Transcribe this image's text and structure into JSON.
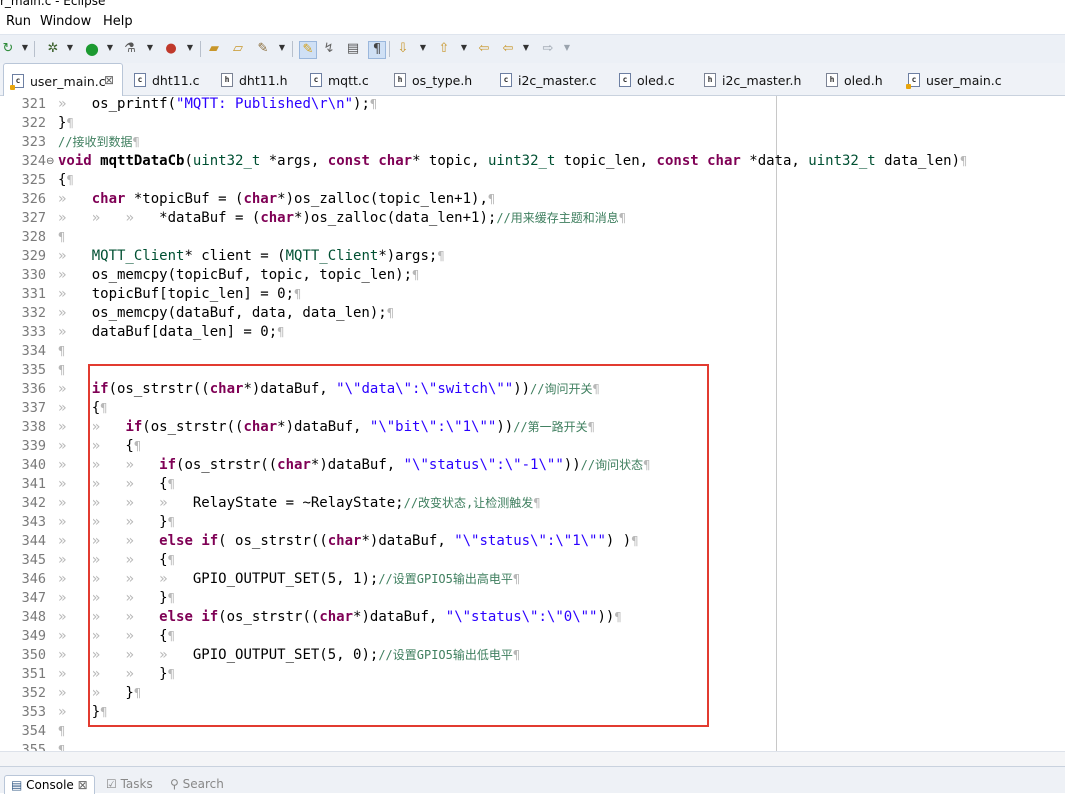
{
  "window": {
    "title": "r_main.c - Eclipse"
  },
  "menu": [
    "Run",
    "Window",
    "Help"
  ],
  "toolbar": {
    "icons": [
      "refresh-icon",
      "debug-icon",
      "run-icon",
      "external-tools-icon",
      "coverage-icon",
      "open-folder-icon",
      "open-file-icon",
      "wand-icon",
      "highlight-icon",
      "toggle-mark-icon",
      "block-select-icon",
      "show-whitespace-icon",
      "next-annotation-icon",
      "previous-annotation-icon",
      "last-edit-icon",
      "back-icon",
      "forward-icon"
    ]
  },
  "tabs": [
    {
      "label": "user_main.c",
      "kind": "c",
      "active": true,
      "close": "⊠",
      "warn": true
    },
    {
      "label": "dht11.c",
      "kind": "c"
    },
    {
      "label": "dht11.h",
      "kind": "h"
    },
    {
      "label": "mqtt.c",
      "kind": "c"
    },
    {
      "label": "os_type.h",
      "kind": "h"
    },
    {
      "label": "i2c_master.c",
      "kind": "c"
    },
    {
      "label": "oled.c",
      "kind": "c"
    },
    {
      "label": "i2c_master.h",
      "kind": "h"
    },
    {
      "label": "oled.h",
      "kind": "h"
    },
    {
      "label": "user_main.c",
      "kind": "c",
      "warn": true
    }
  ],
  "editor": {
    "lines": [
      {
        "n": "321",
        "segs": [
          [
            "g",
            "» "
          ],
          [
            "t",
            "  os_printf("
          ],
          [
            "s",
            "\"MQTT: Published\\r\\n\""
          ],
          [
            "t",
            ");"
          ],
          [
            "p",
            "¶"
          ]
        ]
      },
      {
        "n": "322",
        "segs": [
          [
            "t",
            "}"
          ],
          [
            "p",
            "¶"
          ]
        ]
      },
      {
        "n": "323",
        "segs": [
          [
            "c",
            "//接收到数据"
          ],
          [
            "p",
            "¶"
          ]
        ]
      },
      {
        "n": "324",
        "fold": "⊖",
        "segs": [
          [
            "k",
            "void"
          ],
          [
            "t",
            " "
          ],
          [
            "f",
            "mqttDataCb"
          ],
          [
            "t",
            "("
          ],
          [
            "y",
            "uint32_t"
          ],
          [
            "t",
            " *args, "
          ],
          [
            "k",
            "const"
          ],
          [
            "t",
            " "
          ],
          [
            "k",
            "char"
          ],
          [
            "t",
            "* topic, "
          ],
          [
            "y",
            "uint32_t"
          ],
          [
            "t",
            " topic_len, "
          ],
          [
            "k",
            "const"
          ],
          [
            "t",
            " "
          ],
          [
            "k",
            "char"
          ],
          [
            "t",
            " *data, "
          ],
          [
            "y",
            "uint32_t"
          ],
          [
            "t",
            " data_len)"
          ],
          [
            "p",
            "¶"
          ]
        ]
      },
      {
        "n": "325",
        "segs": [
          [
            "t",
            "{"
          ],
          [
            "p",
            "¶"
          ]
        ]
      },
      {
        "n": "326",
        "segs": [
          [
            "g",
            "» "
          ],
          [
            "t",
            "  "
          ],
          [
            "k",
            "char"
          ],
          [
            "t",
            " *topicBuf = ("
          ],
          [
            "k",
            "char"
          ],
          [
            "t",
            "*)os_zalloc(topic_len+1),"
          ],
          [
            "p",
            "¶"
          ]
        ]
      },
      {
        "n": "327",
        "segs": [
          [
            "g",
            "» "
          ],
          [
            "t",
            "  "
          ],
          [
            "g",
            "» "
          ],
          [
            "t",
            "  "
          ],
          [
            "g",
            "» "
          ],
          [
            "t",
            "  *dataBuf = ("
          ],
          [
            "k",
            "char"
          ],
          [
            "t",
            "*)os_zalloc(data_len+1);"
          ],
          [
            "c",
            "//用来缓存主题和消息"
          ],
          [
            "p",
            "¶"
          ]
        ]
      },
      {
        "n": "328",
        "segs": [
          [
            "p",
            "¶"
          ]
        ]
      },
      {
        "n": "329",
        "segs": [
          [
            "g",
            "» "
          ],
          [
            "t",
            "  "
          ],
          [
            "y",
            "MQTT_Client"
          ],
          [
            "t",
            "* client = ("
          ],
          [
            "y",
            "MQTT_Client"
          ],
          [
            "t",
            "*)args;"
          ],
          [
            "p",
            "¶"
          ]
        ]
      },
      {
        "n": "330",
        "segs": [
          [
            "g",
            "» "
          ],
          [
            "t",
            "  os_memcpy(topicBuf, topic, topic_len);"
          ],
          [
            "p",
            "¶"
          ]
        ]
      },
      {
        "n": "331",
        "segs": [
          [
            "g",
            "» "
          ],
          [
            "t",
            "  topicBuf[topic_len] = 0;"
          ],
          [
            "p",
            "¶"
          ]
        ]
      },
      {
        "n": "332",
        "segs": [
          [
            "g",
            "» "
          ],
          [
            "t",
            "  os_memcpy(dataBuf, data, data_len);"
          ],
          [
            "p",
            "¶"
          ]
        ]
      },
      {
        "n": "333",
        "segs": [
          [
            "g",
            "» "
          ],
          [
            "t",
            "  dataBuf[data_len] = 0;"
          ],
          [
            "p",
            "¶"
          ]
        ]
      },
      {
        "n": "334",
        "segs": [
          [
            "p",
            "¶"
          ]
        ]
      },
      {
        "n": "335",
        "segs": [
          [
            "p",
            "¶"
          ]
        ]
      },
      {
        "n": "336",
        "segs": [
          [
            "g",
            "» "
          ],
          [
            "t",
            "  "
          ],
          [
            "k",
            "if"
          ],
          [
            "t",
            "(os_strstr(("
          ],
          [
            "k",
            "char"
          ],
          [
            "t",
            "*)dataBuf, "
          ],
          [
            "s",
            "\"\\\"data\\\":\\\"switch\\\"\""
          ],
          [
            "t",
            "))"
          ],
          [
            "c",
            "//询问开关"
          ],
          [
            "p",
            "¶"
          ]
        ]
      },
      {
        "n": "337",
        "segs": [
          [
            "g",
            "» "
          ],
          [
            "t",
            "  {"
          ],
          [
            "p",
            "¶"
          ]
        ]
      },
      {
        "n": "338",
        "segs": [
          [
            "g",
            "» "
          ],
          [
            "t",
            "  "
          ],
          [
            "g",
            "» "
          ],
          [
            "t",
            "  "
          ],
          [
            "k",
            "if"
          ],
          [
            "t",
            "(os_strstr(("
          ],
          [
            "k",
            "char"
          ],
          [
            "t",
            "*)dataBuf, "
          ],
          [
            "s",
            "\"\\\"bit\\\":\\\"1\\\"\""
          ],
          [
            "t",
            "))"
          ],
          [
            "c",
            "//第一路开关"
          ],
          [
            "p",
            "¶"
          ]
        ]
      },
      {
        "n": "339",
        "segs": [
          [
            "g",
            "» "
          ],
          [
            "t",
            "  "
          ],
          [
            "g",
            "» "
          ],
          [
            "t",
            "  {"
          ],
          [
            "p",
            "¶"
          ]
        ]
      },
      {
        "n": "340",
        "segs": [
          [
            "g",
            "» "
          ],
          [
            "t",
            "  "
          ],
          [
            "g",
            "» "
          ],
          [
            "t",
            "  "
          ],
          [
            "g",
            "» "
          ],
          [
            "t",
            "  "
          ],
          [
            "k",
            "if"
          ],
          [
            "t",
            "(os_strstr(("
          ],
          [
            "k",
            "char"
          ],
          [
            "t",
            "*)dataBuf, "
          ],
          [
            "s",
            "\"\\\"status\\\":\\\"-1\\\"\""
          ],
          [
            "t",
            "))"
          ],
          [
            "c",
            "//询问状态"
          ],
          [
            "p",
            "¶"
          ]
        ]
      },
      {
        "n": "341",
        "segs": [
          [
            "g",
            "» "
          ],
          [
            "t",
            "  "
          ],
          [
            "g",
            "» "
          ],
          [
            "t",
            "  "
          ],
          [
            "g",
            "» "
          ],
          [
            "t",
            "  {"
          ],
          [
            "p",
            "¶"
          ]
        ]
      },
      {
        "n": "342",
        "segs": [
          [
            "g",
            "» "
          ],
          [
            "t",
            "  "
          ],
          [
            "g",
            "» "
          ],
          [
            "t",
            "  "
          ],
          [
            "g",
            "» "
          ],
          [
            "t",
            "  "
          ],
          [
            "g",
            "» "
          ],
          [
            "t",
            "  RelayState = ~RelayState;"
          ],
          [
            "c",
            "//改变状态,让检测触发"
          ],
          [
            "p",
            "¶"
          ]
        ]
      },
      {
        "n": "343",
        "segs": [
          [
            "g",
            "» "
          ],
          [
            "t",
            "  "
          ],
          [
            "g",
            "» "
          ],
          [
            "t",
            "  "
          ],
          [
            "g",
            "» "
          ],
          [
            "t",
            "  }"
          ],
          [
            "p",
            "¶"
          ]
        ]
      },
      {
        "n": "344",
        "segs": [
          [
            "g",
            "» "
          ],
          [
            "t",
            "  "
          ],
          [
            "g",
            "» "
          ],
          [
            "t",
            "  "
          ],
          [
            "g",
            "» "
          ],
          [
            "t",
            "  "
          ],
          [
            "k",
            "else"
          ],
          [
            "t",
            " "
          ],
          [
            "k",
            "if"
          ],
          [
            "t",
            "( os_strstr(("
          ],
          [
            "k",
            "char"
          ],
          [
            "t",
            "*)dataBuf, "
          ],
          [
            "s",
            "\"\\\"status\\\":\\\"1\\\"\""
          ],
          [
            "t",
            ") )"
          ],
          [
            "p",
            "¶"
          ]
        ]
      },
      {
        "n": "345",
        "segs": [
          [
            "g",
            "» "
          ],
          [
            "t",
            "  "
          ],
          [
            "g",
            "» "
          ],
          [
            "t",
            "  "
          ],
          [
            "g",
            "» "
          ],
          [
            "t",
            "  {"
          ],
          [
            "p",
            "¶"
          ]
        ]
      },
      {
        "n": "346",
        "segs": [
          [
            "g",
            "» "
          ],
          [
            "t",
            "  "
          ],
          [
            "g",
            "» "
          ],
          [
            "t",
            "  "
          ],
          [
            "g",
            "» "
          ],
          [
            "t",
            "  "
          ],
          [
            "g",
            "» "
          ],
          [
            "t",
            "  GPIO_OUTPUT_SET(5, 1);"
          ],
          [
            "c",
            "//设置GPIO5输出高电平"
          ],
          [
            "p",
            "¶"
          ]
        ]
      },
      {
        "n": "347",
        "segs": [
          [
            "g",
            "» "
          ],
          [
            "t",
            "  "
          ],
          [
            "g",
            "» "
          ],
          [
            "t",
            "  "
          ],
          [
            "g",
            "» "
          ],
          [
            "t",
            "  }"
          ],
          [
            "p",
            "¶"
          ]
        ]
      },
      {
        "n": "348",
        "segs": [
          [
            "g",
            "» "
          ],
          [
            "t",
            "  "
          ],
          [
            "g",
            "» "
          ],
          [
            "t",
            "  "
          ],
          [
            "g",
            "» "
          ],
          [
            "t",
            "  "
          ],
          [
            "k",
            "else"
          ],
          [
            "t",
            " "
          ],
          [
            "k",
            "if"
          ],
          [
            "t",
            "(os_strstr(("
          ],
          [
            "k",
            "char"
          ],
          [
            "t",
            "*)dataBuf, "
          ],
          [
            "s",
            "\"\\\"status\\\":\\\"0\\\"\""
          ],
          [
            "t",
            "))"
          ],
          [
            "p",
            "¶"
          ]
        ]
      },
      {
        "n": "349",
        "segs": [
          [
            "g",
            "» "
          ],
          [
            "t",
            "  "
          ],
          [
            "g",
            "» "
          ],
          [
            "t",
            "  "
          ],
          [
            "g",
            "» "
          ],
          [
            "t",
            "  {"
          ],
          [
            "p",
            "¶"
          ]
        ]
      },
      {
        "n": "350",
        "segs": [
          [
            "g",
            "» "
          ],
          [
            "t",
            "  "
          ],
          [
            "g",
            "» "
          ],
          [
            "t",
            "  "
          ],
          [
            "g",
            "» "
          ],
          [
            "t",
            "  "
          ],
          [
            "g",
            "» "
          ],
          [
            "t",
            "  GPIO_OUTPUT_SET(5, 0);"
          ],
          [
            "c",
            "//设置GPIO5输出低电平"
          ],
          [
            "p",
            "¶"
          ]
        ]
      },
      {
        "n": "351",
        "segs": [
          [
            "g",
            "» "
          ],
          [
            "t",
            "  "
          ],
          [
            "g",
            "» "
          ],
          [
            "t",
            "  "
          ],
          [
            "g",
            "» "
          ],
          [
            "t",
            "  }"
          ],
          [
            "p",
            "¶"
          ]
        ]
      },
      {
        "n": "352",
        "segs": [
          [
            "g",
            "» "
          ],
          [
            "t",
            "  "
          ],
          [
            "g",
            "» "
          ],
          [
            "t",
            "  }"
          ],
          [
            "p",
            "¶"
          ]
        ]
      },
      {
        "n": "353",
        "segs": [
          [
            "g",
            "» "
          ],
          [
            "t",
            "  }"
          ],
          [
            "p",
            "¶"
          ]
        ]
      },
      {
        "n": "354",
        "segs": [
          [
            "p",
            "¶"
          ]
        ]
      },
      {
        "n": "355",
        "segs": [
          [
            "p",
            "¶"
          ]
        ]
      }
    ]
  },
  "bottom_tabs": [
    {
      "label": "Console",
      "close": "⊠",
      "active": true
    },
    {
      "label": "Tasks"
    },
    {
      "label": "Search"
    }
  ],
  "colors": {
    "keyword": "#7f0055",
    "string": "#2a00ff",
    "comment": "#3f7f5f",
    "type": "#005032",
    "highlight_box": "#e23b30"
  }
}
